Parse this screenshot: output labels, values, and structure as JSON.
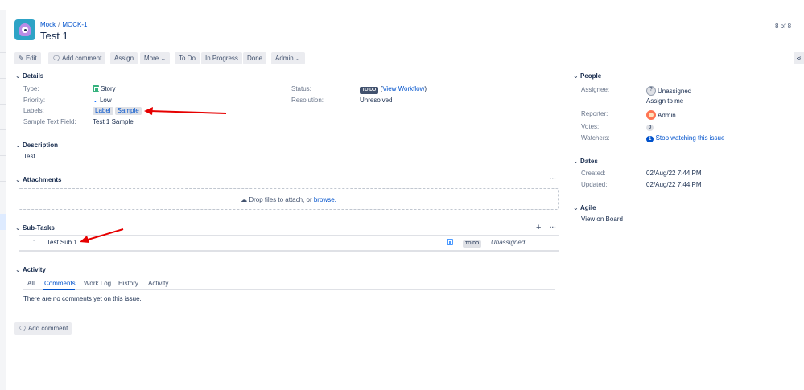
{
  "breadcrumb": {
    "project": "Mock",
    "separator": "/",
    "issue_key": "MOCK-1"
  },
  "issue": {
    "title": "Test 1"
  },
  "pager": "8 of 8",
  "toolbar": {
    "edit": "Edit",
    "add_comment": "Add comment",
    "assign": "Assign",
    "more": "More",
    "todo": "To Do",
    "in_progress": "In Progress",
    "done": "Done",
    "admin": "Admin"
  },
  "details": {
    "heading": "Details",
    "type_label": "Type:",
    "type_value": "Story",
    "priority_label": "Priority:",
    "priority_value": "Low",
    "labels_label": "Labels:",
    "labels": [
      "Label",
      "Sample"
    ],
    "sample_field_label": "Sample Text Field:",
    "sample_field_value": "Test 1 Sample",
    "status_label": "Status:",
    "status_value": "TO DO",
    "view_workflow": "View Workflow",
    "resolution_label": "Resolution:",
    "resolution_value": "Unresolved"
  },
  "description": {
    "heading": "Description",
    "text": "Test"
  },
  "attachments": {
    "heading": "Attachments",
    "drop_text": "Drop files to attach, or",
    "browse": "browse."
  },
  "subtasks": {
    "heading": "Sub-Tasks",
    "items": [
      {
        "number": "1.",
        "summary": "Test Sub 1",
        "status": "TO DO",
        "assignee": "Unassigned"
      }
    ]
  },
  "activity": {
    "heading": "Activity",
    "tabs": [
      "All",
      "Comments",
      "Work Log",
      "History",
      "Activity"
    ],
    "empty": "There are no comments yet on this issue.",
    "add_comment": "Add comment"
  },
  "people": {
    "heading": "People",
    "assignee_label": "Assignee:",
    "assignee_value": "Unassigned",
    "assign_to_me": "Assign to me",
    "reporter_label": "Reporter:",
    "reporter_value": "Admin",
    "votes_label": "Votes:",
    "votes_value": "0",
    "watchers_label": "Watchers:",
    "watchers_count": "1",
    "watchers_link": "Stop watching this issue"
  },
  "dates": {
    "heading": "Dates",
    "created_label": "Created:",
    "created_value": "02/Aug/22 7:44 PM",
    "updated_label": "Updated:",
    "updated_value": "02/Aug/22 7:44 PM"
  },
  "agile": {
    "heading": "Agile",
    "view_on_board": "View on Board"
  },
  "colors": {
    "link": "#0052cc",
    "annotation_arrow": "#e60000",
    "button_bg": "#ebecf0"
  }
}
